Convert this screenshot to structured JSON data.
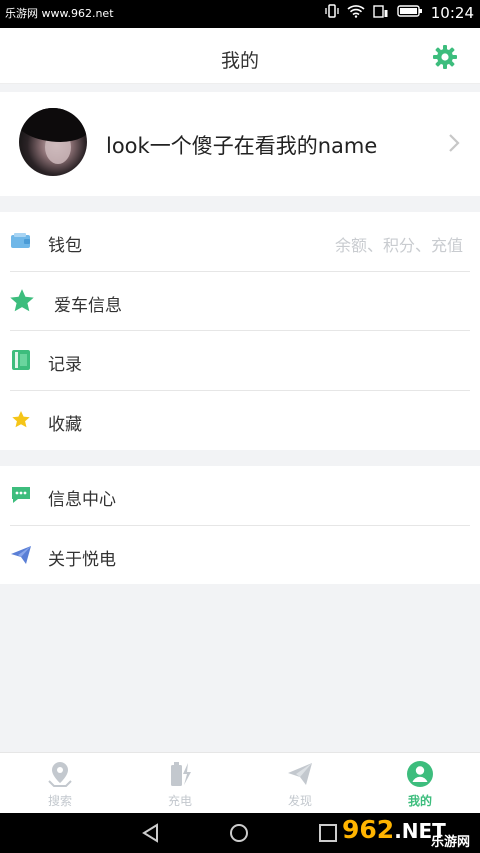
{
  "status_bar": {
    "watermark": "乐游网 www.962.net",
    "time": "10:24"
  },
  "header": {
    "title": "我的",
    "settings_icon": "gear-icon"
  },
  "profile": {
    "name": "look一个傻子在看我的name"
  },
  "menu_group_1": [
    {
      "label": "钱包",
      "hint": "余额、积分、充值",
      "icon": "wallet-icon"
    },
    {
      "label": "爱车信息",
      "icon": "star-icon"
    },
    {
      "label": "记录",
      "icon": "notebook-icon"
    },
    {
      "label": "收藏",
      "icon": "favorite-star-icon"
    }
  ],
  "menu_group_2": [
    {
      "label": "信息中心",
      "icon": "message-icon"
    },
    {
      "label": "关于悦电",
      "icon": "paper-plane-icon"
    }
  ],
  "tabs": [
    {
      "label": "搜索",
      "icon": "map-pin-icon",
      "active": false
    },
    {
      "label": "充电",
      "icon": "battery-charge-icon",
      "active": false
    },
    {
      "label": "发现",
      "icon": "paper-plane-icon",
      "active": false
    },
    {
      "label": "我的",
      "icon": "user-icon",
      "active": true
    }
  ],
  "colors": {
    "accent": "#3dbd7d",
    "inactive": "#c3c8ce",
    "wallet": "#6fb7e8",
    "favorite": "#f5c518",
    "send": "#5a7fd6"
  },
  "watermark_logo": {
    "big": "962",
    "suffix": ".NET",
    "small": "乐游网"
  }
}
